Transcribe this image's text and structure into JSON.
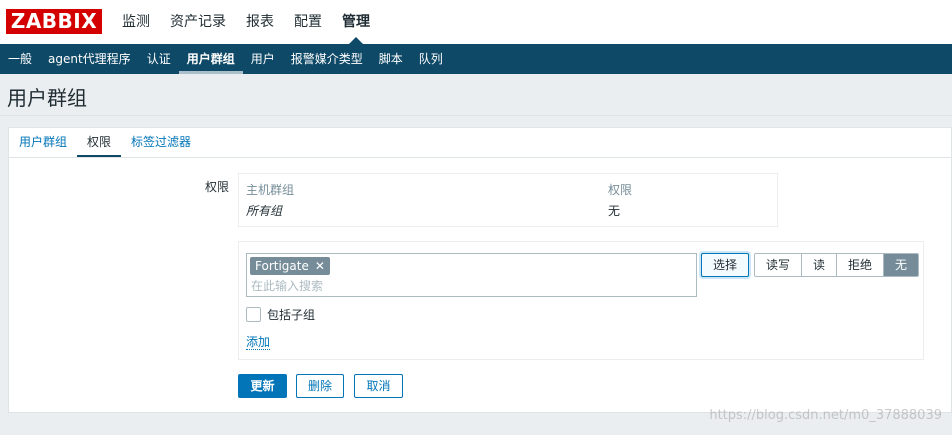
{
  "header": {
    "logo_text": "ZABBIX",
    "menu": [
      {
        "label": "监测"
      },
      {
        "label": "资产记录"
      },
      {
        "label": "报表"
      },
      {
        "label": "配置"
      },
      {
        "label": "管理",
        "active": true
      }
    ]
  },
  "subnav": {
    "items": [
      {
        "label": "一般"
      },
      {
        "label": "agent代理程序"
      },
      {
        "label": "认证"
      },
      {
        "label": "用户群组",
        "active": true
      },
      {
        "label": "用户"
      },
      {
        "label": "报警媒介类型"
      },
      {
        "label": "脚本"
      },
      {
        "label": "队列"
      }
    ]
  },
  "page": {
    "title": "用户群组"
  },
  "tabs": [
    {
      "label": "用户群组"
    },
    {
      "label": "权限",
      "active": true
    },
    {
      "label": "标签过滤器"
    }
  ],
  "permissions": {
    "field_label": "权限",
    "columns": [
      "主机群组",
      "权限"
    ],
    "rows": [
      {
        "group": "所有组",
        "permission": "无"
      }
    ]
  },
  "add_permission": {
    "selected_chip": "Fortigate",
    "chip_remove_glyph": "✕",
    "search_placeholder": "在此输入搜索",
    "select_button": "选择",
    "options": [
      "读写",
      "读",
      "拒绝",
      "无"
    ],
    "selected_option": "无",
    "include_subgroups_label": "包括子组",
    "include_subgroups_checked": false,
    "add_link": "添加"
  },
  "actions": {
    "update": "更新",
    "delete": "删除",
    "cancel": "取消"
  },
  "watermark": "https://blog.csdn.net/m0_37888039",
  "colors": {
    "brand_red": "#d40000",
    "nav_blue": "#0e4967",
    "link_blue": "#0275b8",
    "selected_gray": "#768d99"
  }
}
